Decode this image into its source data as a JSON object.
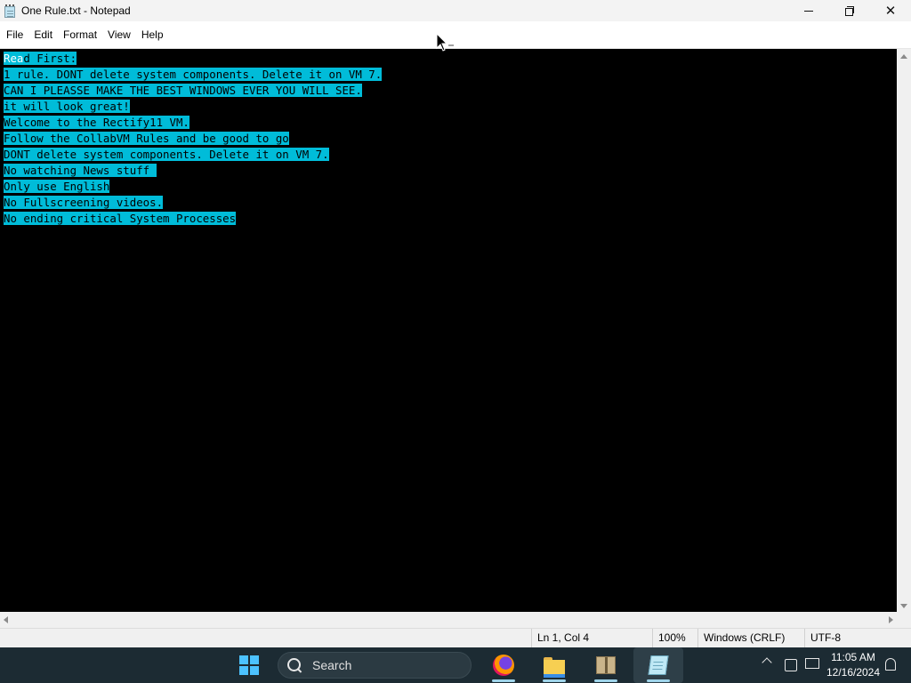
{
  "window": {
    "title": "One Rule.txt - Notepad",
    "controls": {
      "minimize": "minimize",
      "restore": "restore",
      "close": "close"
    }
  },
  "menu": [
    "File",
    "Edit",
    "Format",
    "View",
    "Help"
  ],
  "document": {
    "lines": [
      "Read First:",
      "1 rule. DONT delete system components. Delete it on VM 7.",
      "CAN I PLEASSE MAKE THE BEST WINDOWS EVER YOU WILL SEE.",
      "it will look great!",
      "Welcome to the Rectify11 VM.",
      "Follow the CollabVM Rules and be good to go",
      "DONT delete system components. Delete it on VM 7.",
      "No watching News stuff ",
      "Only use English",
      "No Fullscreening videos.",
      "No ending critical System Processes"
    ],
    "selection_color": "#00bcd9"
  },
  "status": {
    "position": "Ln 1, Col 4",
    "zoom": "100%",
    "line_ending": "Windows (CRLF)",
    "encoding": "UTF-8"
  },
  "taskbar": {
    "search_placeholder": "Search",
    "apps": [
      "start-icon",
      "firefox-icon",
      "file-explorer-icon",
      "archive-icon",
      "notepad-icon"
    ],
    "clock_time": "11:05 AM",
    "clock_date": "12/16/2024",
    "accent": "#4cc2ff"
  }
}
